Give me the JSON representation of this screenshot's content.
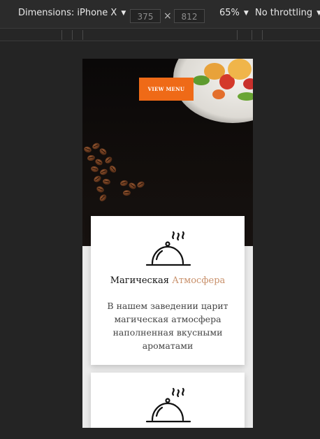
{
  "devtools": {
    "device_label": "Dimensions: iPhone X",
    "width": "375",
    "height": "812",
    "times": "×",
    "zoom": "65%",
    "throttle": "No throttling"
  },
  "hero": {
    "button_label": "VIEW MENU"
  },
  "cards": [
    {
      "icon": "cloche-icon",
      "title_part1": "Магическая",
      "title_part2": "Атмосфера",
      "text": "В нашем заведении царит магическая атмосфера наполненная вкусными ароматами"
    },
    {
      "icon": "cloche-icon"
    }
  ],
  "colors": {
    "accent": "#ef6a17",
    "title_accent": "#c8906a"
  }
}
